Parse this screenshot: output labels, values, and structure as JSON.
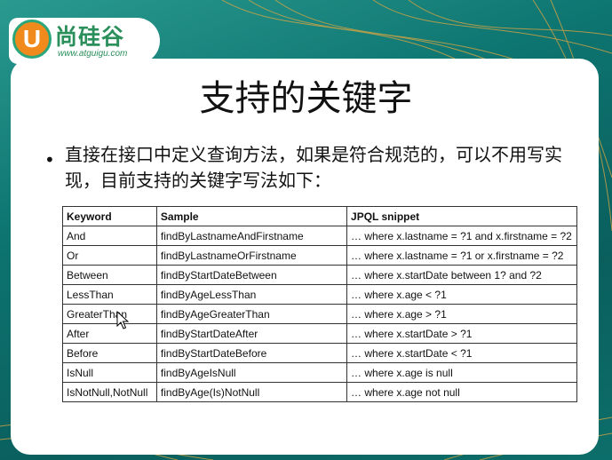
{
  "slide": {
    "title": "支持的关键字",
    "description": "直接在接口中定义查询方法，如果是符合规范的，可以不用写实现，目前支持的关键字写法如下：",
    "bullet": "•"
  },
  "logo": {
    "letter": "U",
    "name": "尚硅谷",
    "url": "www.atguigu.com"
  },
  "table": {
    "headers": [
      "Keyword",
      "Sample",
      "JPQL snippet"
    ],
    "rows": [
      [
        "And",
        "findByLastnameAndFirstname",
        "… where x.lastname = ?1 and x.firstname = ?2"
      ],
      [
        "Or",
        "findByLastnameOrFirstname",
        "… where x.lastname = ?1 or x.firstname = ?2"
      ],
      [
        "Between",
        "findByStartDateBetween",
        "… where x.startDate between 1? and ?2"
      ],
      [
        "LessThan",
        "findByAgeLessThan",
        "… where x.age < ?1"
      ],
      [
        "GreaterThan",
        "findByAgeGreaterThan",
        "… where x.age > ?1"
      ],
      [
        "After",
        "findByStartDateAfter",
        "… where x.startDate > ?1"
      ],
      [
        "Before",
        "findByStartDateBefore",
        "… where x.startDate < ?1"
      ],
      [
        "IsNull",
        "findByAgeIsNull",
        "… where x.age is null"
      ],
      [
        "IsNotNull,NotNull",
        "findByAge(Is)NotNull",
        "… where x.age not null"
      ]
    ]
  },
  "colors": {
    "background": "#0d7470",
    "accent_orange": "#f08a1c",
    "accent_green": "#2a8f5a"
  },
  "icons": {
    "cursor": "mouse-pointer-icon"
  }
}
